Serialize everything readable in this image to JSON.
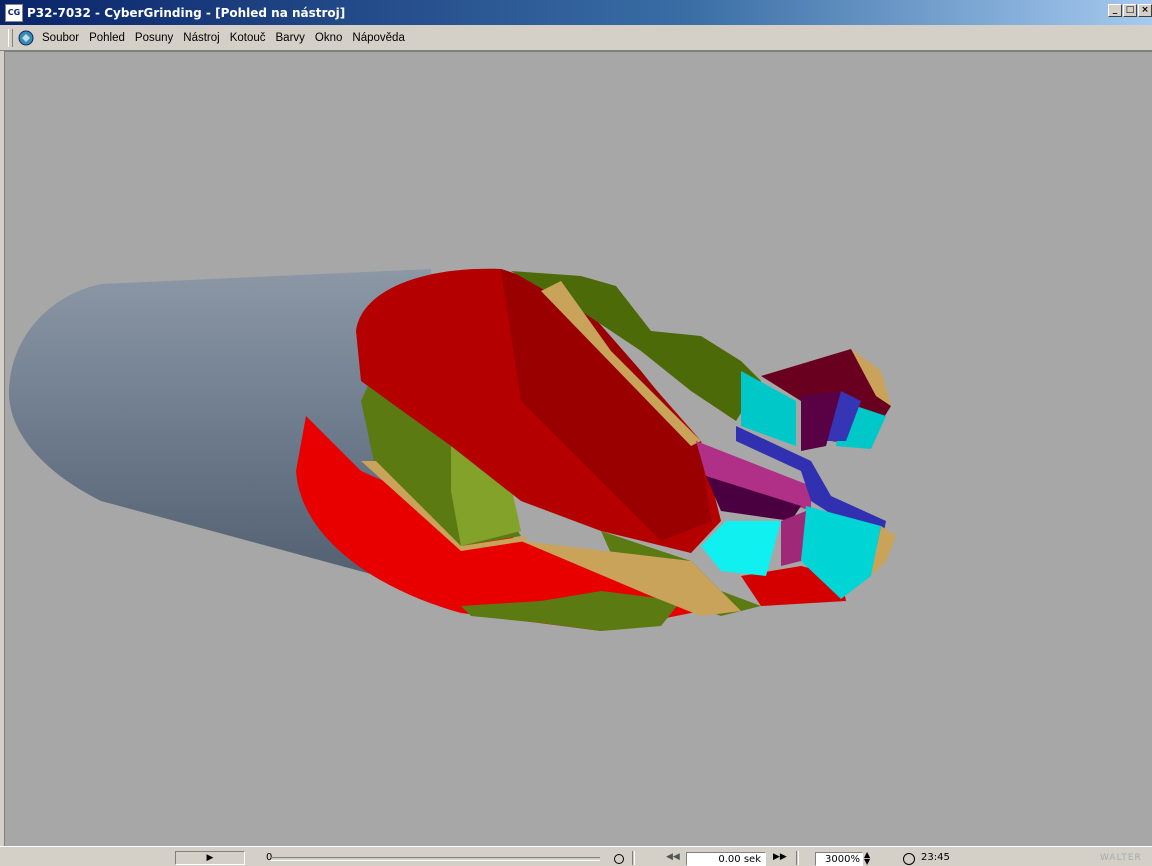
{
  "window": {
    "title": "P32-7032 - CyberGrinding - [Pohled na nástroj]",
    "icon_text": "CG"
  },
  "menu": {
    "items": [
      {
        "label": "Soubor",
        "name": "menu-soubor"
      },
      {
        "label": "Pohled",
        "name": "menu-pohled"
      },
      {
        "label": "Posuny",
        "name": "menu-posuny"
      },
      {
        "label": "Nástroj",
        "name": "menu-nastroj"
      },
      {
        "label": "Kotouč",
        "name": "menu-kotouc"
      },
      {
        "label": "Barvy",
        "name": "menu-barvy"
      },
      {
        "label": "Okno",
        "name": "menu-okno"
      },
      {
        "label": "Nápověda",
        "name": "menu-napoveda"
      }
    ]
  },
  "viewport": {
    "background": "#a7a7a7",
    "model": "end-mill-3d-view",
    "colors": {
      "shank": "#7a8797",
      "flute": "#cc0000",
      "land": "#5a7a10",
      "margin": "#c8a050",
      "tip_face": "#00e0e0",
      "tip_edge": "#3030b0",
      "tip_magenta": "#a02878"
    }
  },
  "status": {
    "play_icon": "play-icon",
    "slider_value": "0",
    "time_value": "0.00 sek",
    "zoom_value": "3000%",
    "clock_time": "23:45",
    "logo": "WALTER"
  }
}
